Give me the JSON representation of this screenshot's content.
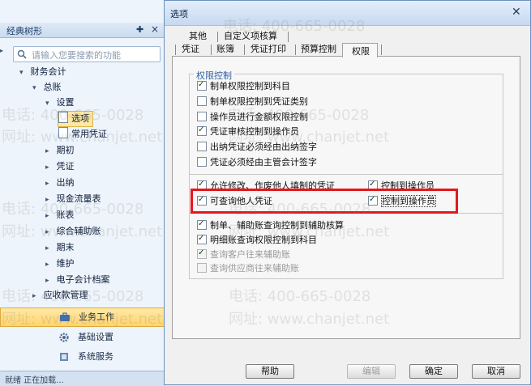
{
  "left_panel": {
    "title": "经典树形",
    "pin_icon": "pin-icon",
    "close_icon": "close-icon",
    "search_placeholder": "请输入您要搜索的功能",
    "tree": [
      {
        "label": "财务会计",
        "level": 0,
        "expanded": true
      },
      {
        "label": "总账",
        "level": 1,
        "expanded": true
      },
      {
        "label": "设置",
        "level": 2,
        "expanded": true
      },
      {
        "label": "选项",
        "level": 3,
        "selected": true,
        "doc": true
      },
      {
        "label": "常用凭证",
        "level": 3,
        "doc": true
      },
      {
        "label": "期初",
        "level": 2
      },
      {
        "label": "凭证",
        "level": 2
      },
      {
        "label": "出纳",
        "level": 2
      },
      {
        "label": "现金流量表",
        "level": 2
      },
      {
        "label": "账表",
        "level": 2
      },
      {
        "label": "综合辅助账",
        "level": 2
      },
      {
        "label": "期末",
        "level": 2
      },
      {
        "label": "维护",
        "level": 2
      },
      {
        "label": "电子会计档案",
        "level": 2
      },
      {
        "label": "应收款管理",
        "level": 1
      }
    ],
    "nav": [
      {
        "label": "业务工作",
        "active": true
      },
      {
        "label": "基础设置",
        "active": false
      },
      {
        "label": "系统服务",
        "active": false
      }
    ],
    "status": "就绪 正在加载..."
  },
  "dialog": {
    "title": "选项",
    "tabs_row1": [
      "其他",
      "自定义项核算"
    ],
    "tabs_row2": [
      "凭证",
      "账簿",
      "凭证打印",
      "预算控制",
      "权限"
    ],
    "active_tab": "权限",
    "group_title": "权限控制",
    "options_top": [
      {
        "label": "制单权限控制到科目",
        "checked": true
      },
      {
        "label": "制单权限控制到凭证类别",
        "checked": false
      },
      {
        "label": "操作员进行金额权限控制",
        "checked": false
      },
      {
        "label": "凭证审核控制到操作员",
        "checked": true
      },
      {
        "label": "出纳凭证必须经由出纳签字",
        "checked": false
      },
      {
        "label": "凭证必须经由主管会计签字",
        "checked": false
      }
    ],
    "options_mid_left": [
      {
        "label": "允许修改、作废他人填制的凭证",
        "checked": true
      },
      {
        "label": "可查询他人凭证",
        "checked": true
      }
    ],
    "options_mid_right": [
      {
        "label": "控制到操作员",
        "checked": true
      },
      {
        "label": "控制到操作员",
        "checked": true
      }
    ],
    "options_bottom": [
      {
        "label": "制单、辅助账查询控制到辅助核算",
        "checked": true,
        "disabled": false
      },
      {
        "label": "明细账查询权限控制到科目",
        "checked": true,
        "disabled": false
      },
      {
        "label": "查询客户往来辅助账",
        "checked": true,
        "disabled": true
      },
      {
        "label": "查询供应商往来辅助账",
        "checked": false,
        "disabled": true
      }
    ],
    "buttons": {
      "help": "帮助",
      "edit": "编辑",
      "ok": "确定",
      "cancel": "取消"
    },
    "highlight_color": "#e5171d"
  },
  "watermarks": [
    "电话: 400-665-0028",
    "网址: www.chanjet.net"
  ]
}
